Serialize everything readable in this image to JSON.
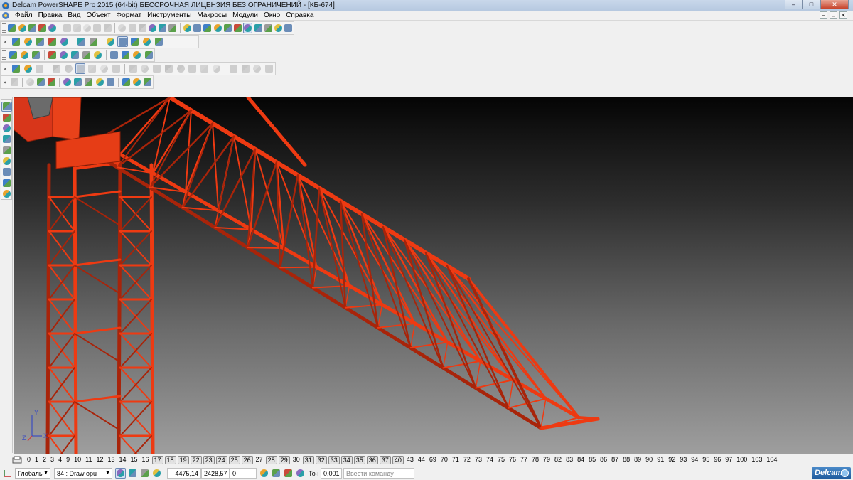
{
  "titlebar": {
    "title": "Delcam PowerSHAPE Pro 2015 (64-bit) БЕССРОЧНАЯ ЛИЦЕНЗИЯ БЕЗ ОГРАНИЧЕНИЙ - [КБ-674]",
    "minimize": "–",
    "maximize": "□",
    "close": "✕"
  },
  "menu": {
    "items": [
      "Файл",
      "Правка",
      "Вид",
      "Объект",
      "Формат",
      "Инструменты",
      "Макросы",
      "Модули",
      "Окно",
      "Справка"
    ],
    "mdi_minimize": "–",
    "mdi_restore": "□",
    "mdi_close": "✕"
  },
  "toolbars": {
    "close_glyph": "×",
    "row1": {
      "icons": [
        "select-icon",
        "new-icon",
        "open-icon",
        "save-icon",
        "save-as-icon",
        "cut-icon",
        "copy-icon",
        "paste-icon",
        "delete-icon",
        "repair-icon",
        "undo-icon",
        "redo-icon",
        "edit-icon",
        "line-icon",
        "arc-icon",
        "curve-icon",
        "point-icon",
        "workplane-icon",
        "dimension-icon",
        "text-icon",
        "circle-icon",
        "spline-icon",
        "fillet-icon",
        "symbol-icon",
        "surface-icon",
        "solid-icon",
        "feature-icon"
      ]
    },
    "row2": {
      "icons": [
        "view-front-icon",
        "view-back-icon",
        "view-left-icon",
        "view-iso-icon",
        "view-rotate-icon",
        "zoom-fit-icon",
        "zoom-in-icon",
        "globe-icon",
        "shaded-icon",
        "wireframe-icon",
        "lightbulb-icon",
        "layers-icon"
      ]
    },
    "row3": {
      "icons": [
        "properties-icon",
        "document-icon",
        "page-icon",
        "cube-icon",
        "sphere-icon",
        "cone-icon",
        "cylinder-icon",
        "block-icon",
        "model-icon",
        "tree-icon",
        "assembly-icon",
        "export-icon"
      ]
    },
    "row4": {
      "icons": [
        "selection-icon",
        "point-select-icon",
        "wire-select-icon",
        "box-select-icon",
        "rotate-view-icon",
        "zoom-view-icon",
        "pan-view-icon",
        "box-zoom-icon",
        "fit-view-icon",
        "cube-view-1-icon",
        "cube-view-2-icon",
        "cube-view-3-icon",
        "cube-view-4-icon",
        "cube-view-5-icon",
        "cube-view-6-icon",
        "cube-view-7-icon",
        "cube-view-8-icon",
        "mirror-view-icon",
        "section-icon",
        "clip-icon",
        "render-icon"
      ]
    },
    "row5": {
      "icons": [
        "axis-icon",
        "coordinate-icon",
        "part-icon",
        "solid-block-icon",
        "solid-cylinder-icon",
        "solid-cone-icon",
        "solid-sphere-icon",
        "boolean-icon",
        "draft-icon",
        "shell-icon",
        "chain-icon",
        "sweep-icon"
      ]
    }
  },
  "left_toolbar": {
    "icons": [
      "cursor-icon",
      "tree-view-icon",
      "object-icon",
      "layer-icon",
      "color-icon",
      "material-icon",
      "surface-sel-icon",
      "curve-sel-icon",
      "solid-sel-icon"
    ]
  },
  "levels": {
    "items": [
      {
        "label": "0",
        "used": false
      },
      {
        "label": "1",
        "used": false
      },
      {
        "label": "2",
        "used": false
      },
      {
        "label": "3",
        "used": false
      },
      {
        "label": "4",
        "used": false
      },
      {
        "label": "9",
        "used": false
      },
      {
        "label": "10",
        "used": false
      },
      {
        "label": "11",
        "used": false
      },
      {
        "label": "12",
        "used": false
      },
      {
        "label": "13",
        "used": false
      },
      {
        "label": "14",
        "used": false
      },
      {
        "label": "15",
        "used": false
      },
      {
        "label": "16",
        "used": false
      },
      {
        "label": "17",
        "used": true
      },
      {
        "label": "18",
        "used": true
      },
      {
        "label": "19",
        "used": true
      },
      {
        "label": "22",
        "used": true
      },
      {
        "label": "23",
        "used": true
      },
      {
        "label": "24",
        "used": true
      },
      {
        "label": "25",
        "used": true
      },
      {
        "label": "26",
        "used": true
      },
      {
        "label": "27",
        "used": false
      },
      {
        "label": "28",
        "used": true
      },
      {
        "label": "29",
        "used": true
      },
      {
        "label": "30",
        "used": false
      },
      {
        "label": "31",
        "used": true
      },
      {
        "label": "32",
        "used": true
      },
      {
        "label": "33",
        "used": true
      },
      {
        "label": "34",
        "used": true
      },
      {
        "label": "35",
        "used": true
      },
      {
        "label": "36",
        "used": true
      },
      {
        "label": "37",
        "used": true
      },
      {
        "label": "40",
        "used": true
      },
      {
        "label": "43",
        "used": false
      },
      {
        "label": "44",
        "used": false
      },
      {
        "label": "69",
        "used": false
      },
      {
        "label": "70",
        "used": false
      },
      {
        "label": "71",
        "used": false
      },
      {
        "label": "72",
        "used": false
      },
      {
        "label": "73",
        "used": false
      },
      {
        "label": "74",
        "used": false
      },
      {
        "label": "75",
        "used": false
      },
      {
        "label": "76",
        "used": false
      },
      {
        "label": "77",
        "used": false
      },
      {
        "label": "78",
        "used": false
      },
      {
        "label": "79",
        "used": false
      },
      {
        "label": "82",
        "used": false
      },
      {
        "label": "83",
        "used": false
      },
      {
        "label": "84",
        "used": false
      },
      {
        "label": "85",
        "used": false
      },
      {
        "label": "86",
        "used": false
      },
      {
        "label": "87",
        "used": false
      },
      {
        "label": "88",
        "used": false
      },
      {
        "label": "89",
        "used": false
      },
      {
        "label": "90",
        "used": false
      },
      {
        "label": "91",
        "used": false
      },
      {
        "label": "92",
        "used": false
      },
      {
        "label": "93",
        "used": false
      },
      {
        "label": "94",
        "used": false
      },
      {
        "label": "95",
        "used": false
      },
      {
        "label": "96",
        "used": false
      },
      {
        "label": "97",
        "used": false
      },
      {
        "label": "100",
        "used": false
      },
      {
        "label": "103",
        "used": false
      },
      {
        "label": "104",
        "used": false
      }
    ]
  },
  "statusbar": {
    "workplane": "Глобаль",
    "level": "84 : Draw opu",
    "x": "4475,14",
    "y": "2428,57",
    "z": "0",
    "tolerance_label": "Точ",
    "tolerance": "0,001",
    "command_placeholder": "Ввести команду",
    "logo": "Delcam"
  },
  "viewport": {
    "axis_x": "X",
    "axis_y": "Y",
    "axis_z": "Z",
    "model_color": "#ee3a12",
    "model_shade": "#a8240a"
  }
}
